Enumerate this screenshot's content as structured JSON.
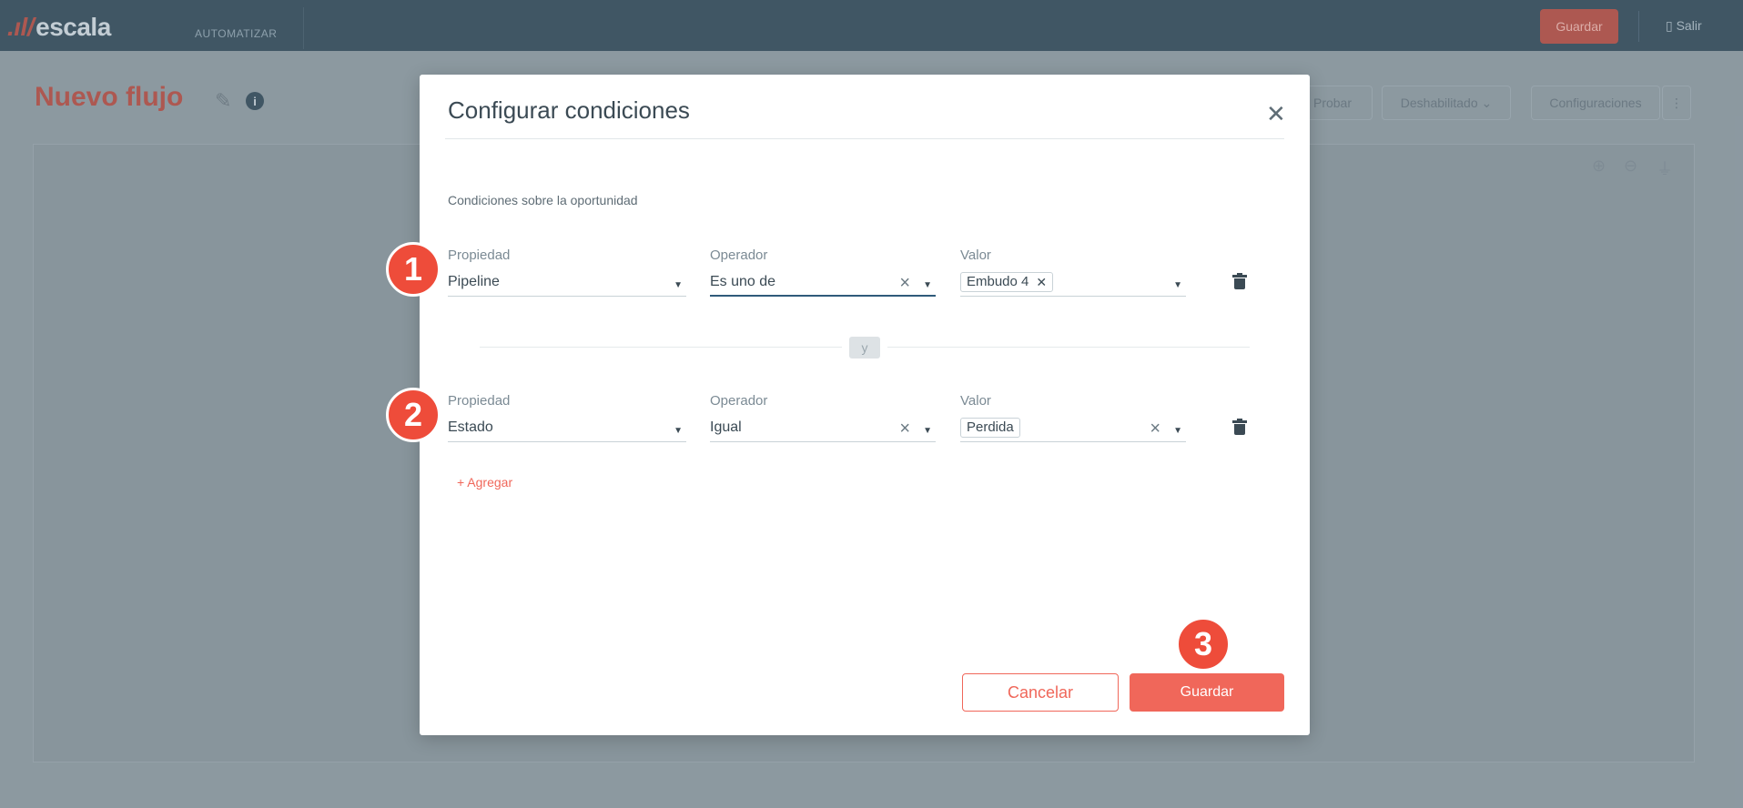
{
  "app": {
    "logo": "escala",
    "nav_item": "AUTOMATIZAR",
    "save_label": "Guardar",
    "exit_label": "Salir"
  },
  "page": {
    "title": "Nuevo flujo",
    "actions": [
      "Probar",
      "Deshabilitado",
      "Configuraciones"
    ]
  },
  "modal": {
    "title": "Configurar condiciones",
    "section_label": "Condiciones sobre la oportunidad",
    "conditions": [
      {
        "property_label": "Propiedad",
        "property_value": "Pipeline",
        "operator_label": "Operador",
        "operator_value": "Es uno de",
        "value_label": "Valor",
        "value_chip": "Embudo 4"
      },
      {
        "property_label": "Propiedad",
        "property_value": "Estado",
        "operator_label": "Operador",
        "operator_value": "Igual",
        "value_label": "Valor",
        "value_chip": "Perdida"
      }
    ],
    "joiner": "y",
    "add_label": "+ Agregar",
    "cancel_label": "Cancelar",
    "save_label": "Guardar"
  },
  "steps": [
    "1",
    "2",
    "3"
  ],
  "colors": {
    "accent": "#f0675a",
    "step_marker": "#ee4c3a",
    "topbar": "#3e5563"
  }
}
